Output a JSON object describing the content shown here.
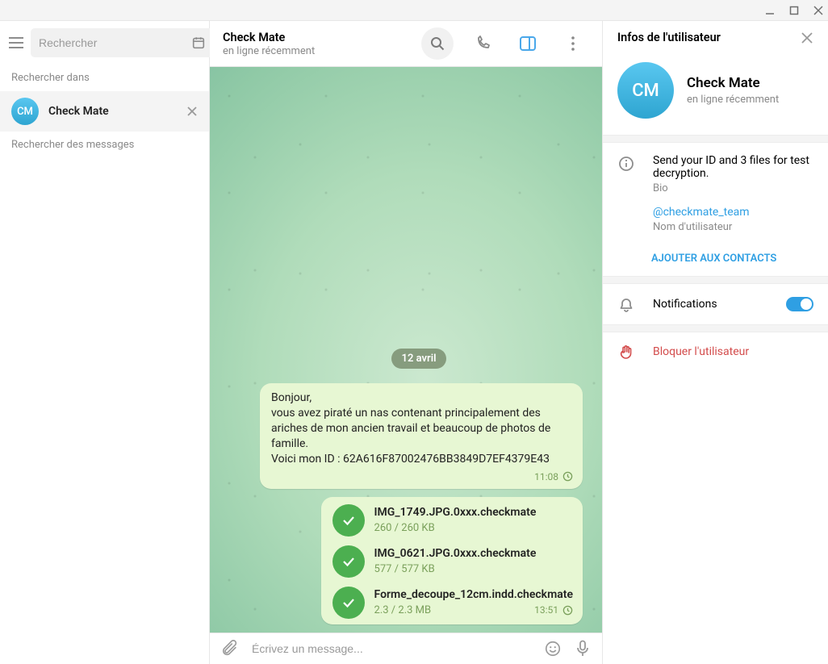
{
  "sidebar": {
    "search_placeholder": "Rechercher",
    "section_search_in": "Rechercher dans",
    "section_search_messages": "Rechercher des messages",
    "chat_name": "Check Mate",
    "chat_initials": "CM"
  },
  "chat_header": {
    "title": "Check Mate",
    "subtitle": "en ligne récemment"
  },
  "chat": {
    "date_label": "12 avril",
    "message1": {
      "line1": "Bonjour,",
      "line2": "vous avez piraté un nas contenant principalement des ariches de mon ancien travail et beaucoup de photos de famille.",
      "line3": "Voici mon ID : 62A616F87002476BB3849D7EF4379E43",
      "time": "11:08"
    },
    "files": [
      {
        "name": "IMG_1749.JPG.0xxx.checkmate",
        "size": "260 / 260 KB"
      },
      {
        "name": "IMG_0621.JPG.0xxx.checkmate",
        "size": "577 / 577 KB"
      },
      {
        "name": "Forme_decoupe_12cm.indd.checkmate",
        "size": "2.3 / 2.3 MB"
      }
    ],
    "files_time": "13:51",
    "input_placeholder": "Écrivez un message..."
  },
  "info": {
    "header": "Infos de l'utilisateur",
    "name": "Check Mate",
    "initials": "CM",
    "status": "en ligne récemment",
    "bio_text": "Send your ID and 3 files for test decryption.",
    "bio_label": "Bio",
    "username": "@checkmate_team",
    "username_label": "Nom d'utilisateur",
    "add_contacts": "AJOUTER AUX CONTACTS",
    "notifications_label": "Notifications",
    "block_label": "Bloquer l'utilisateur"
  }
}
